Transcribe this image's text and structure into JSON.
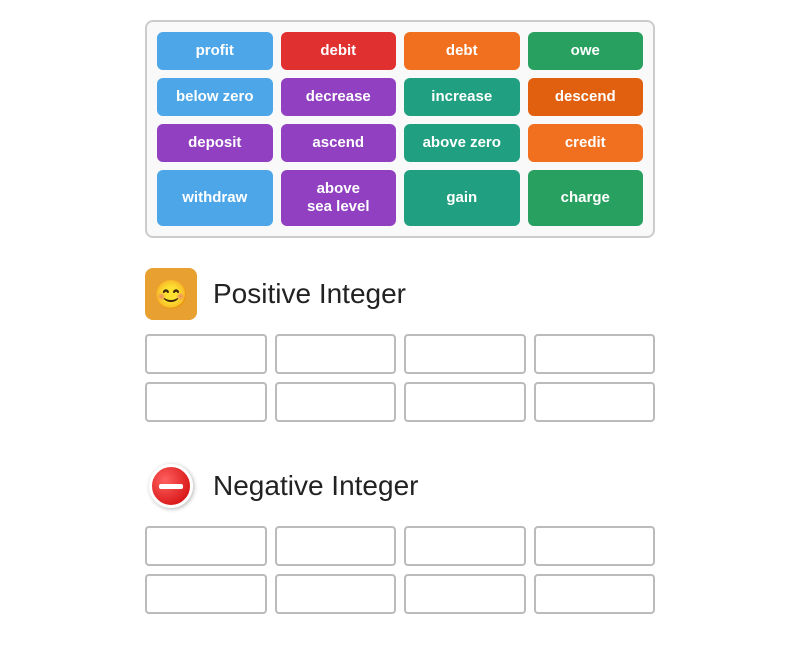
{
  "wordBank": {
    "words": [
      {
        "id": "profit",
        "label": "profit",
        "color": "chip-blue"
      },
      {
        "id": "debit",
        "label": "debit",
        "color": "chip-red"
      },
      {
        "id": "debt",
        "label": "debt",
        "color": "chip-orange"
      },
      {
        "id": "owe",
        "label": "owe",
        "color": "chip-green"
      },
      {
        "id": "below-zero",
        "label": "below zero",
        "color": "chip-blue"
      },
      {
        "id": "decrease",
        "label": "decrease",
        "color": "chip-purple"
      },
      {
        "id": "increase",
        "label": "increase",
        "color": "chip-teal"
      },
      {
        "id": "descend",
        "label": "descend",
        "color": "chip-orange-dark"
      },
      {
        "id": "deposit",
        "label": "deposit",
        "color": "chip-purple"
      },
      {
        "id": "ascend",
        "label": "ascend",
        "color": "chip-purple"
      },
      {
        "id": "above-zero",
        "label": "above zero",
        "color": "chip-teal"
      },
      {
        "id": "credit",
        "label": "credit",
        "color": "chip-orange2"
      },
      {
        "id": "withdraw",
        "label": "withdraw",
        "color": "chip-blue"
      },
      {
        "id": "above-sea",
        "label": "above\nsea level",
        "color": "chip-purple"
      },
      {
        "id": "gain",
        "label": "gain",
        "color": "chip-teal"
      },
      {
        "id": "charge",
        "label": "charge",
        "color": "chip-green"
      }
    ]
  },
  "categories": {
    "positive": {
      "title": "Positive Integer",
      "iconEmoji": "😊",
      "iconBg": "#e8a030",
      "dropRows": 2,
      "dropCols": 4
    },
    "negative": {
      "title": "Negative Integer",
      "dropRows": 2,
      "dropCols": 4
    }
  }
}
